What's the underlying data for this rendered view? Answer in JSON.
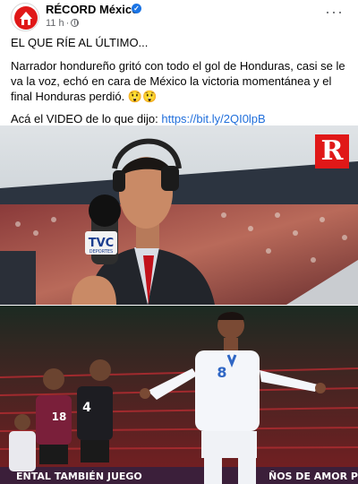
{
  "post": {
    "page_name": "RÉCORD México",
    "verified_icon": "verified-badge-icon",
    "time": "11 h",
    "separator": "·",
    "audience_icon": "globe-icon",
    "more_icon": "more-options-icon",
    "headline": "EL QUE RÍE AL ÚLTIMO...",
    "body": "Narrador hondureño gritó con todo el gol de Honduras, casi se le va la voz, echó en cara de México la victoria momentánea y el final Honduras perdió. 😲😲",
    "video_prefix": "Acá el VIDEO de lo que dijo: ",
    "video_link": "https://bit.ly/2QI0lpB"
  },
  "photos": {
    "first": {
      "watermark": "R",
      "mic_flag": "TVC",
      "mic_flag_sub": "DEPORTES"
    },
    "second": {
      "mexico_player_numbers": [
        "18",
        "4"
      ],
      "honduras_player_number": "8",
      "banner_text_left": "ENTAL TAMBIÉN JUEGO",
      "banner_text_right": "ÑOS DE AMOR PO"
    }
  },
  "colors": {
    "link": "#216fdb",
    "verified": "#1b74e4",
    "brand_red": "#e01818",
    "meta_text": "#65676b"
  }
}
